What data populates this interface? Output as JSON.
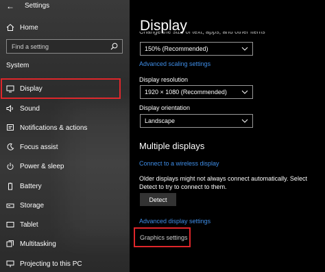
{
  "header": {
    "back_glyph": "←",
    "app_title": "Settings"
  },
  "sidebar": {
    "home_label": "Home",
    "search_placeholder": "Find a setting",
    "section_title": "System",
    "items": [
      {
        "label": "Display",
        "icon": "monitor-icon",
        "selected": true
      },
      {
        "label": "Sound",
        "icon": "speaker-icon"
      },
      {
        "label": "Notifications & actions",
        "icon": "notification-icon"
      },
      {
        "label": "Focus assist",
        "icon": "moon-icon"
      },
      {
        "label": "Power & sleep",
        "icon": "power-icon"
      },
      {
        "label": "Battery",
        "icon": "battery-icon"
      },
      {
        "label": "Storage",
        "icon": "storage-icon"
      },
      {
        "label": "Tablet",
        "icon": "tablet-icon"
      },
      {
        "label": "Multitasking",
        "icon": "multitasking-icon"
      },
      {
        "label": "Projecting to this PC",
        "icon": "projector-icon"
      }
    ]
  },
  "main": {
    "title": "Display",
    "cut_off_text": "Change the size of text, apps, and other items",
    "scale_value": "150% (Recommended)",
    "advanced_scaling_link": "Advanced scaling settings",
    "resolution_label": "Display resolution",
    "resolution_value": "1920 × 1080 (Recommended)",
    "orientation_label": "Display orientation",
    "orientation_value": "Landscape",
    "multiple_displays_heading": "Multiple displays",
    "wireless_link": "Connect to a wireless display",
    "older_displays_text": "Older displays might not always connect automatically. Select Detect to try to connect to them.",
    "detect_button": "Detect",
    "advanced_display_link": "Advanced display settings",
    "graphics_settings_link": "Graphics settings"
  },
  "colors": {
    "link": "#3f8ee8",
    "highlight": "#e0262a",
    "sidebar_bg": "#2f2f2f",
    "main_bg": "#000000"
  }
}
